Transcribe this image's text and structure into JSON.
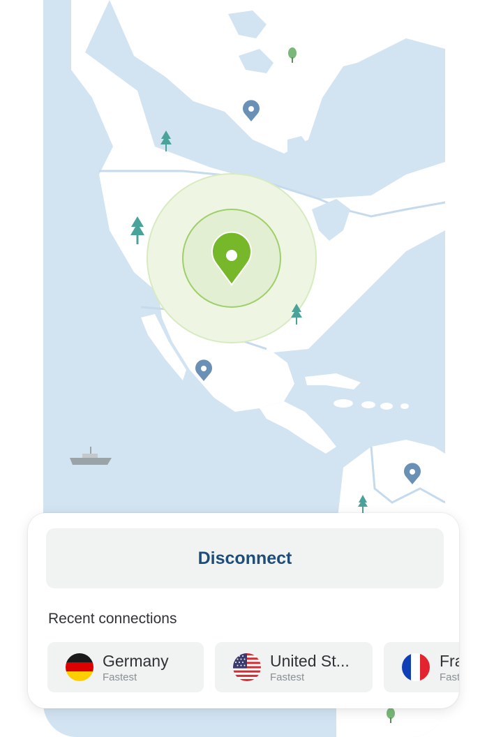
{
  "map": {
    "colors": {
      "water": "#d2e3f2",
      "land": "#ffffff",
      "coast": "#c6daee",
      "pin": "#6a91b5",
      "pin_active": "#77b82a",
      "tree": "#4aa39a"
    }
  },
  "panel": {
    "disconnect_label": "Disconnect",
    "recent_title": "Recent connections",
    "connections": [
      {
        "country": "Germany",
        "server": "Fastest",
        "flag": "germany-flag-icon"
      },
      {
        "country": "United St...",
        "server": "Fastest",
        "flag": "usa-flag-icon"
      },
      {
        "country": "Fra",
        "server": "Fast",
        "flag": "france-flag-icon"
      }
    ]
  }
}
